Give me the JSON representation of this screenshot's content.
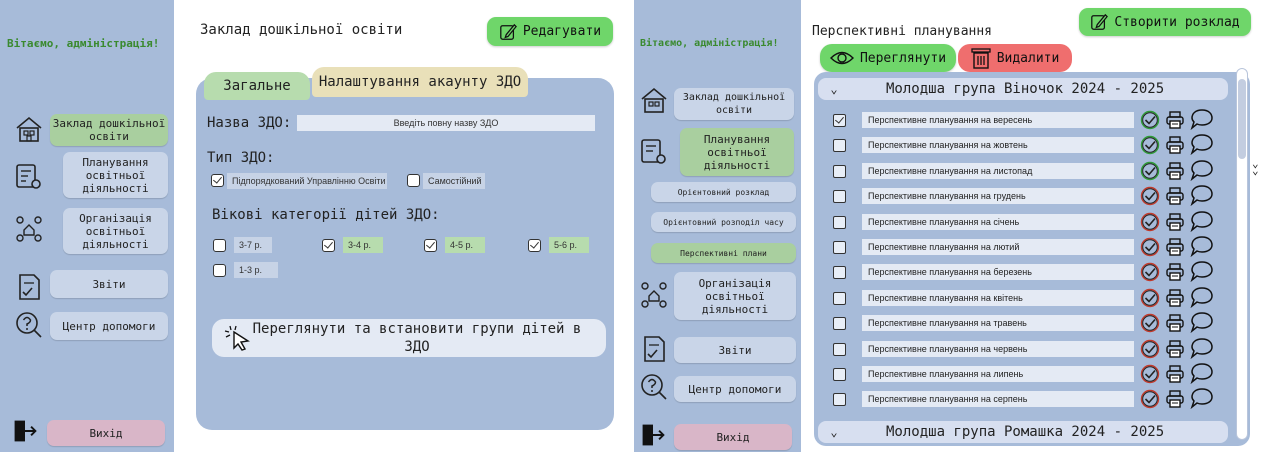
{
  "left_screen": {
    "sidebar": {
      "welcome": "Вітаємо, адміністрація!",
      "items": [
        {
          "label": "Заклад дошкільної освіти",
          "icon": "kindergarten-icon"
        },
        {
          "label": "Планування освітньої діяльності",
          "icon": "planning-gear-icon"
        },
        {
          "label": "Організація освітньої діяльності",
          "icon": "organization-icon"
        },
        {
          "label": "Звіти",
          "icon": "report-check-icon"
        },
        {
          "label": "Центр допомоги",
          "icon": "help-icon"
        }
      ],
      "exit_label": "Вихід"
    },
    "header": {
      "title": "Заклад дошкільної освіти",
      "edit_label": "Редагувати"
    },
    "tabs": [
      "Загальне",
      "Налаштування акаунту ЗДО"
    ],
    "form": {
      "name_label": "Назва ЗДО:",
      "name_placeholder": "Введіть повну назву ЗДО",
      "type_label": "Тип ЗДО:",
      "type_options": [
        {
          "label": "Підпорядкований Управлінню Освіти",
          "checked": true
        },
        {
          "label": "Самостійний",
          "checked": false
        }
      ],
      "age_label": "Вікові категорії дітей ЗДО:",
      "age_options": [
        {
          "label": "3-7 р.",
          "checked": false
        },
        {
          "label": "3-4 р.",
          "checked": true
        },
        {
          "label": "4-5 р.",
          "checked": true
        },
        {
          "label": "5-6 р.",
          "checked": true
        },
        {
          "label": "1-3 р.",
          "checked": false
        }
      ],
      "groups_button": "Переглянути та встановити групи дітей в ЗДО"
    }
  },
  "right_screen": {
    "sidebar": {
      "welcome": "Вітаємо, адміністрація!",
      "items": [
        {
          "label": "Заклад дошкільної освіти",
          "icon": "kindergarten-icon"
        },
        {
          "label": "Планування освітньої діяльності",
          "icon": "planning-gear-icon"
        },
        {
          "label": "Орієнтовний розклад"
        },
        {
          "label": "Орієнтовний розподіл часу"
        },
        {
          "label": "Перспективні плани"
        },
        {
          "label": "Організація освітньої діяльності",
          "icon": "organization-icon"
        },
        {
          "label": "Звіти",
          "icon": "report-check-icon"
        },
        {
          "label": "Центр допомоги",
          "icon": "help-icon"
        }
      ],
      "exit_label": "Вихід"
    },
    "header": {
      "title": "Перспективні планування",
      "create_label": "Створити розклад",
      "view_label": "Переглянути",
      "delete_label": "Видалити"
    },
    "groups": [
      "Молодша група Віночок 2024 - 2025",
      "Молодша група Ромашка 2024 - 2025"
    ],
    "rows": [
      {
        "label": "Перспективне планування на вересень",
        "checked": true,
        "status": "green"
      },
      {
        "label": "Перспективне планування на жовтень",
        "checked": false,
        "status": "green"
      },
      {
        "label": "Перспективне планування на листопад",
        "checked": false,
        "status": "green"
      },
      {
        "label": "Перспективне планування на грудень",
        "checked": false,
        "status": "red"
      },
      {
        "label": "Перспективне планування на січень",
        "checked": false,
        "status": "red"
      },
      {
        "label": "Перспективне планування на лютий",
        "checked": false,
        "status": "red"
      },
      {
        "label": "Перспективне планування на березень",
        "checked": false,
        "status": "red"
      },
      {
        "label": "Перспективне планування на квітень",
        "checked": false,
        "status": "red"
      },
      {
        "label": "Перспективне планування на травень",
        "checked": false,
        "status": "red"
      },
      {
        "label": "Перспективне планування на червень",
        "checked": false,
        "status": "red"
      },
      {
        "label": "Перспективне планування на липень",
        "checked": false,
        "status": "red"
      },
      {
        "label": "Перспективне планування на серпень",
        "checked": false,
        "status": "red"
      }
    ]
  },
  "colors": {
    "sidebar_bg": "#a7bbd9",
    "button_bg": "#c9d5e8",
    "active_green": "#a9cf9f",
    "accent_green": "#6fd66a",
    "accent_red": "#ef6e6e",
    "exit_pink": "#d9b6c8",
    "welcome_text": "#3a8a2f"
  }
}
